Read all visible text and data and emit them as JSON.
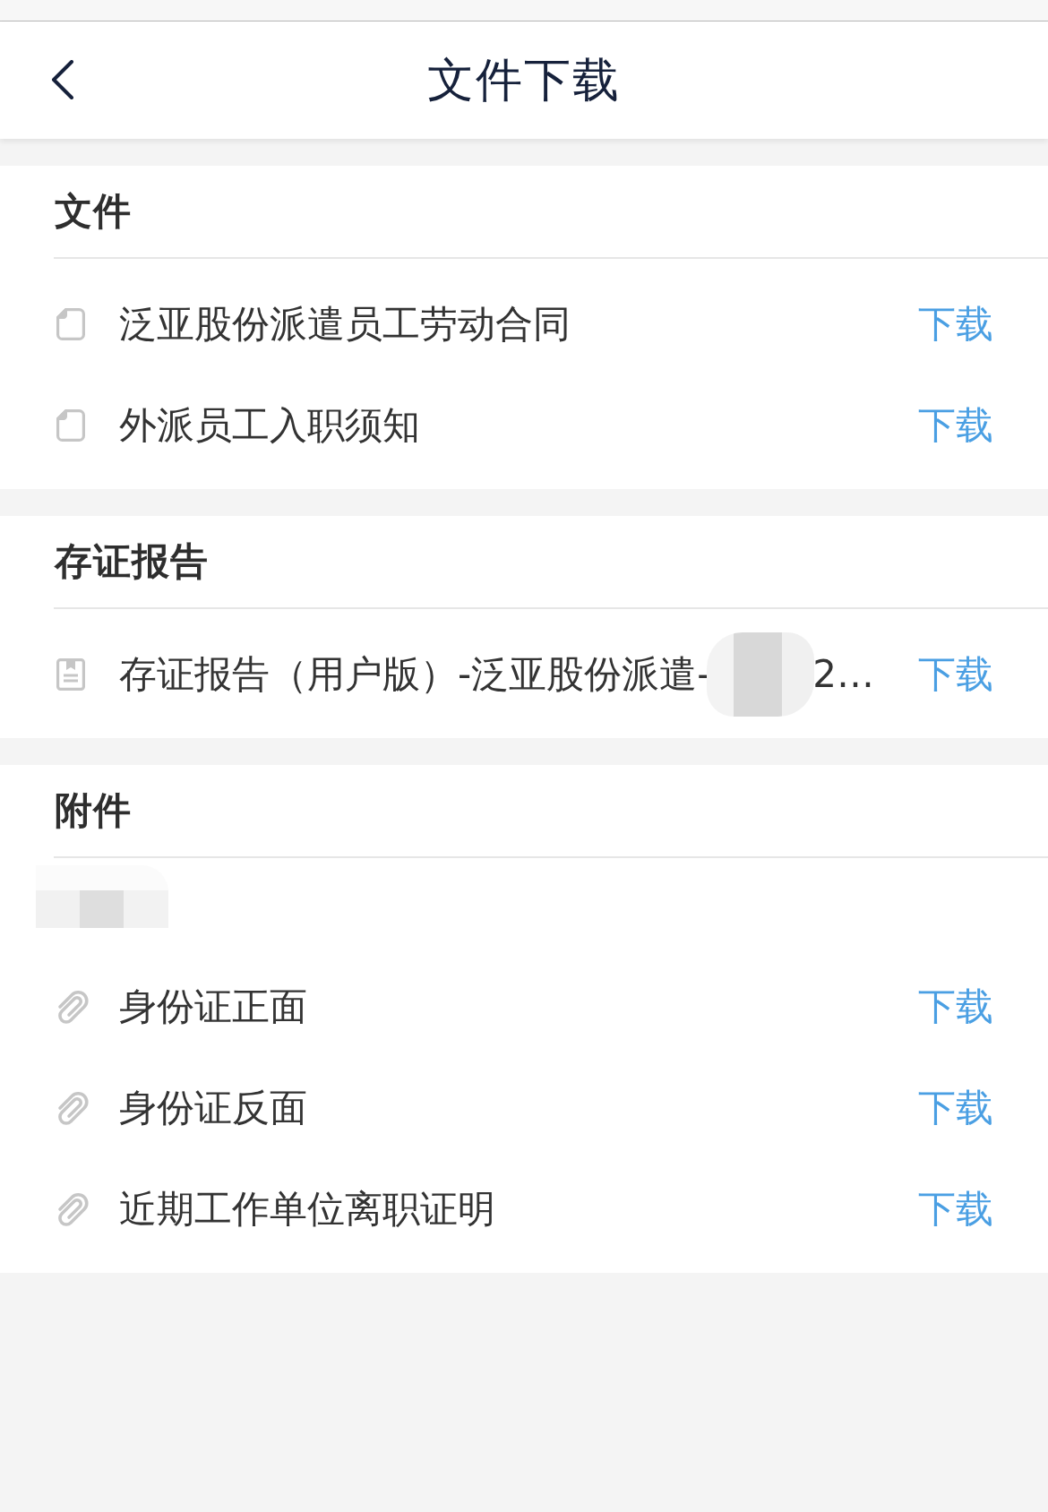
{
  "header": {
    "title": "文件下载"
  },
  "sections": [
    {
      "title": "文件",
      "redacted_note": false,
      "items": [
        {
          "kind": "document",
          "name": "泛亚股份派遣员工劳动合同",
          "redacted": false,
          "action": "下载"
        },
        {
          "kind": "document",
          "name": "外派员工入职须知",
          "redacted": false,
          "action": "下载"
        }
      ]
    },
    {
      "title": "存证报告",
      "redacted_note": false,
      "items": [
        {
          "kind": "report",
          "name": "存证报告（用户版）-泛亚股份派遣-",
          "redacted": true,
          "name_tail": "2…",
          "action": "下载"
        }
      ]
    },
    {
      "title": "附件",
      "redacted_note": true,
      "items": [
        {
          "kind": "attachment",
          "name": "身份证正面",
          "redacted": false,
          "action": "下载"
        },
        {
          "kind": "attachment",
          "name": "身份证反面",
          "redacted": false,
          "action": "下载"
        },
        {
          "kind": "attachment",
          "name": "近期工作单位离职证明",
          "redacted": false,
          "action": "下载"
        }
      ]
    }
  ]
}
